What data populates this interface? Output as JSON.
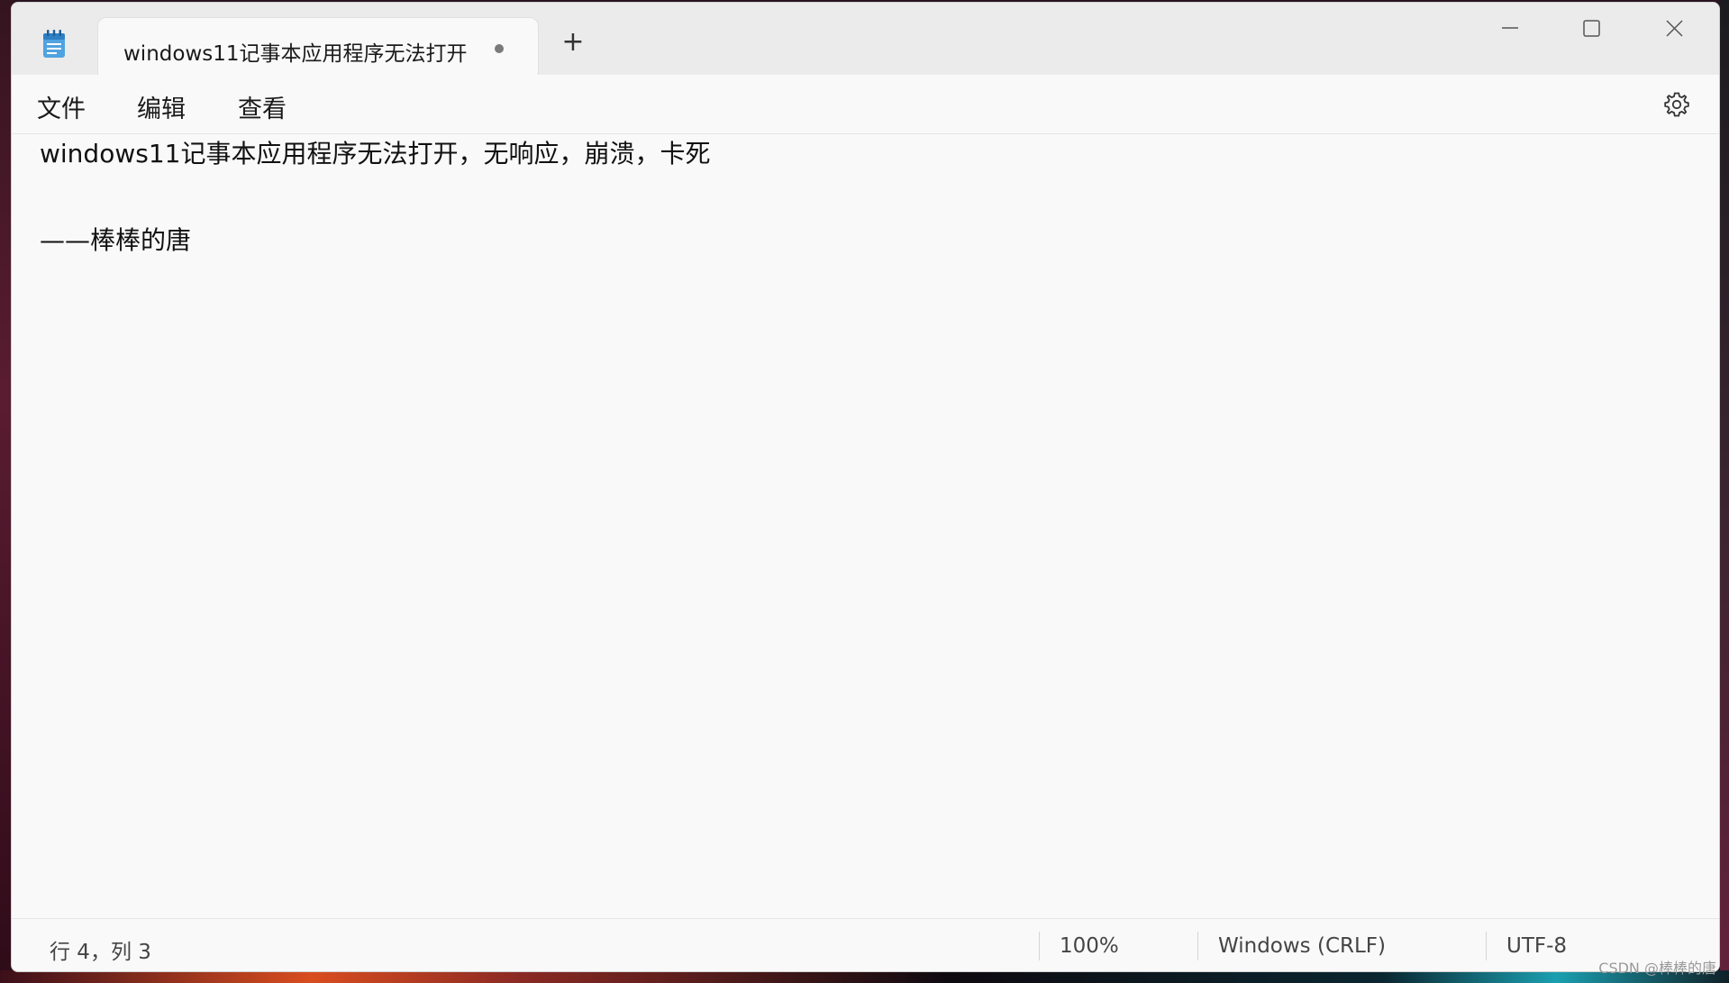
{
  "window": {
    "tab_title": "windows11记事本应用程序无法打开",
    "new_tab_label": "+"
  },
  "menu": {
    "items": [
      "文件",
      "编辑",
      "查看"
    ]
  },
  "editor": {
    "lines": [
      "windows11记事本应用程序无法打开，无响应，崩溃，卡死",
      "",
      "——棒棒的唐",
      ""
    ]
  },
  "status": {
    "position": "行 4，列 3",
    "zoom": "100%",
    "line_ending": "Windows (CRLF)",
    "encoding": "UTF-8"
  },
  "watermark": "CSDN @棒棒的唐",
  "icons": {
    "app": "notepad-icon",
    "settings": "gear-icon",
    "minimize": "minimize-icon",
    "maximize": "maximize-icon",
    "close": "close-icon"
  },
  "colors": {
    "titlebar_bg": "#ebebeb",
    "content_bg": "#f9f9f9",
    "unsaved_dot": "#7a7a7a"
  }
}
